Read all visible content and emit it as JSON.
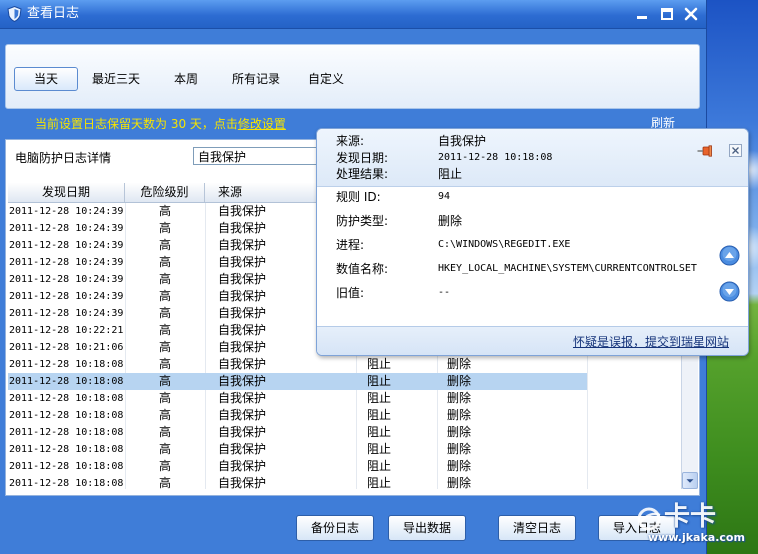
{
  "window": {
    "title": "查看日志"
  },
  "icons": {
    "app": "shield-icon",
    "minimize": "minimize-icon",
    "maximize": "maximize-icon",
    "close": "close-icon",
    "pin": "pin-icon",
    "popup_close": "close-icon",
    "scroll_up": "arrow-up-icon",
    "scroll_down": "arrow-down-icon"
  },
  "tabs": [
    {
      "label": "当天",
      "selected": true
    },
    {
      "label": "最近三天",
      "selected": false
    },
    {
      "label": "本周",
      "selected": false
    },
    {
      "label": "所有记录",
      "selected": false
    },
    {
      "label": "自定义",
      "selected": false
    }
  ],
  "notice": {
    "text": "当前设置日志保留天数为 30 天，点击",
    "link": "修改设置"
  },
  "refresh_label": "刷新",
  "log_panel": {
    "label": "电脑防护日志详情",
    "filter_value": "自我保护"
  },
  "table": {
    "columns": [
      "发现日期",
      "危险级别",
      "来源"
    ],
    "selected_index": 10,
    "rows": [
      {
        "date": "2011-12-28 10:24:39",
        "level": "高",
        "source": "自我保护"
      },
      {
        "date": "2011-12-28 10:24:39",
        "level": "高",
        "source": "自我保护"
      },
      {
        "date": "2011-12-28 10:24:39",
        "level": "高",
        "source": "自我保护"
      },
      {
        "date": "2011-12-28 10:24:39",
        "level": "高",
        "source": "自我保护"
      },
      {
        "date": "2011-12-28 10:24:39",
        "level": "高",
        "source": "自我保护"
      },
      {
        "date": "2011-12-28 10:24:39",
        "level": "高",
        "source": "自我保护"
      },
      {
        "date": "2011-12-28 10:24:39",
        "level": "高",
        "source": "自我保护"
      },
      {
        "date": "2011-12-28 10:22:21",
        "level": "高",
        "source": "自我保护"
      },
      {
        "date": "2011-12-28 10:21:06",
        "level": "高",
        "source": "自我保护"
      },
      {
        "date": "2011-12-28 10:18:08",
        "level": "高",
        "source": "自我保护",
        "result": "阻止",
        "action": "删除"
      },
      {
        "date": "2011-12-28 10:18:08",
        "level": "高",
        "source": "自我保护",
        "result": "阻止",
        "action": "删除"
      },
      {
        "date": "2011-12-28 10:18:08",
        "level": "高",
        "source": "自我保护",
        "result": "阻止",
        "action": "删除"
      },
      {
        "date": "2011-12-28 10:18:08",
        "level": "高",
        "source": "自我保护",
        "result": "阻止",
        "action": "删除"
      },
      {
        "date": "2011-12-28 10:18:08",
        "level": "高",
        "source": "自我保护",
        "result": "阻止",
        "action": "删除"
      },
      {
        "date": "2011-12-28 10:18:08",
        "level": "高",
        "source": "自我保护",
        "result": "阻止",
        "action": "删除"
      },
      {
        "date": "2011-12-28 10:18:08",
        "level": "高",
        "source": "自我保护",
        "result": "阻止",
        "action": "删除"
      },
      {
        "date": "2011-12-28 10:18:08",
        "level": "高",
        "source": "自我保护",
        "result": "阻止",
        "action": "删除"
      }
    ]
  },
  "popup": {
    "summary": [
      {
        "label": "来源:",
        "value": "自我保护"
      },
      {
        "label": "发现日期:",
        "value": "2011-12-28 10:18:08"
      },
      {
        "label": "处理结果:",
        "value": "阻止"
      }
    ],
    "details": [
      {
        "label": "规则 ID:",
        "value": "94"
      },
      {
        "label": "防护类型:",
        "value": "删除"
      },
      {
        "label": "进程:",
        "value": "C:\\WINDOWS\\REGEDIT.EXE"
      },
      {
        "label": "数值名称:",
        "value": "HKEY_LOCAL_MACHINE\\SYSTEM\\CURRENTCONTROLSET"
      },
      {
        "label": "旧值:",
        "value": "--"
      }
    ],
    "report_link": "怀疑是误报，提交到瑞星网站"
  },
  "buttons": [
    "备份日志",
    "导出数据",
    "清空日志",
    "导入日志"
  ],
  "watermark": {
    "logo": "卡卡",
    "url": "www.jkaka.com"
  },
  "colors": {
    "window_blue": "#3f7dd8",
    "notice_yellow": "#f6e400",
    "selection": "#b7d4f1",
    "link": "#15337a"
  }
}
